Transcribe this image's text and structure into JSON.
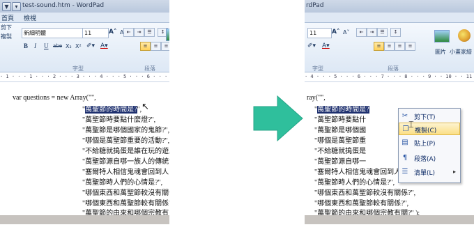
{
  "left": {
    "title": "test-sound.htm - WordPad",
    "tabs": [
      "首頁",
      "檢視"
    ],
    "side_labels": [
      "剪下",
      "複製"
    ],
    "font_name": "新細明體",
    "font_size": "11",
    "grow_font": "A˄",
    "shrink_font": "A˅",
    "bold": "B",
    "italic": "I",
    "underline": "U",
    "strike": "abe",
    "subscript": "X₂",
    "superscript": "X²",
    "font_group_label": "字型",
    "paragraph_group_label": "段落",
    "picture_label": "圖片",
    "paint_label": "小畫家",
    "ruler": "· 1 · · · 1 · · · 2 · · · 3 · · · 4 · · · 5 · · · 6 · · · 7 · · · 8 · · · 9 · · 10 · · 11",
    "code_first": "var questions = new Array(\"\",",
    "lines": [
      "\"萬聖節時要點什麼燈?\",",
      "\"萬聖節是哪個國家的鬼節?\",",
      "\"哪個是萬聖節重要的活動?\",",
      "\"不給糖就搗蛋是誰在玩的遊戲?\",",
      "\"萬聖節源自哪一族人的傳統?\",",
      "\"塞爾特人相信鬼魂會回到人間,所以?\",",
      "\"萬聖節時人們的心情是?\",",
      "\"哪個東西和萬聖節較沒有關係?\",",
      "\"哪個東西和萬聖節較有關係?\",",
      "\"萬聖節的由來和哪個宗教有關?\" );"
    ],
    "selected_pre": "\"",
    "selected_text": "萬聖節的時間是?",
    "selected_post": "\","
  },
  "right": {
    "title": "rdPad",
    "font_size": "11",
    "grow_font": "A˄",
    "shrink_font": "A˅",
    "font_group_label": "字型",
    "paragraph_group_label": "段落",
    "picture_label": "圖片",
    "paint_label": "小畫家繪",
    "ruler": "· 4 · · · 5 · · · 6 · · · 7 · · · 8 · · · 9 · · 10 · · 11",
    "code_first": "ray(\"\",",
    "selected_pre": "\"",
    "selected_text": "萬聖節的時間是?",
    "lines": [
      "\"萬聖節時要點什",
      "\"萬聖節是哪個國",
      "\"哪個是萬聖節重",
      "\"不給糖就搗蛋是",
      "\"萬聖節源自哪一",
      "\"塞爾特人相信鬼魂會回到人間,所以?\",",
      "\"萬聖節時人們的心情是?\",",
      "\"哪個東西和萬聖節較沒有關係?\",",
      "\"哪個東西和萬聖節較有關係?\",",
      "\"萬聖節的由來和哪個宗教有關?\" );"
    ],
    "line4_tail": "?\",",
    "context_menu": [
      {
        "icon": "scissors-icon",
        "glyph": "✂",
        "label": "剪下(T)"
      },
      {
        "icon": "copy-icon",
        "glyph": "❐",
        "label": "複製(C)"
      },
      {
        "icon": "paste-icon",
        "glyph": "▤",
        "label": "貼上(P)"
      },
      {
        "icon": "paragraph-icon",
        "glyph": "¶",
        "label": "段落(A)"
      },
      {
        "icon": "list-icon",
        "glyph": "☰",
        "label": "清單(L)"
      }
    ],
    "submenu_arrow": "▸"
  },
  "colors": {
    "selection": "#1d2f6e",
    "arrow": "#2fbf9c",
    "statusbar": "#c7c3bf"
  }
}
